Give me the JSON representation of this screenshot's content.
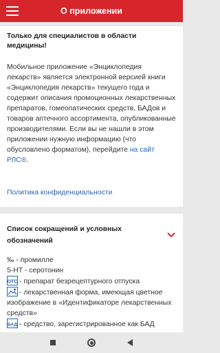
{
  "appbar": {
    "title": "О приложении"
  },
  "about": {
    "heading": "Только для специалистов в области медицины!",
    "body": "Мобильное приложение «Энциклопедия лекарств» является электронной версией книги «Энциклопедия лекарств» текущего года и содержит описания промоционных лекарственных препаратов, гомеопатических средств, БАДов и товаров аптечного ассортимента, опубликованные производителями. Если вы не нашли в этом приложении нужную информацию (что обусловлено форматом), перейдите ",
    "link": "на сайт РЛС®",
    "link_suffix": ".",
    "policy": "Политика конфиденциальности"
  },
  "abbreviations": {
    "title": "Список сокращений и условных обозначений",
    "items": [
      {
        "text": "‰ - промилле"
      },
      {
        "text": "5-HT - серотонин"
      },
      {
        "icon": "otc-icon",
        "text": "- препарат безрецептурного отпуска"
      },
      {
        "icon": "image-icon",
        "text": "- лекарственная форма, имеющая цветное изображение в «Идентификаторе лекарственных средств»"
      },
      {
        "icon": "bad-icon",
        "text": "- средство, зарегистрированное как БАД"
      }
    ]
  },
  "colors": {
    "accent": "#d6262b",
    "link": "#2a64b3"
  }
}
